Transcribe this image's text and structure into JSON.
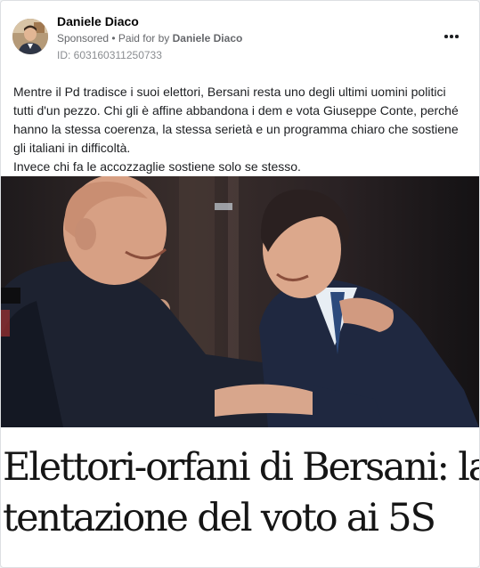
{
  "post": {
    "page_name": "Daniele Diaco",
    "sponsored_label": "Sponsored",
    "paid_for_prefix": " • Paid for by ",
    "paid_for_name": "Daniele Diaco",
    "ad_id": "ID: 603160311250733",
    "menu_icon": "more-horizontal-icon",
    "text_lines": [
      "Mentre il Pd tradisce i suoi elettori, Bersani resta uno degli ultimi uomini politici",
      "tutti d'un pezzo. Chi gli è affine abbandona i dem e vota Giuseppe Conte, perché",
      "hanno la stessa coerenza, la stessa serietà e un programma chiaro che sostiene",
      "gli italiani in difficoltà.",
      "Invece chi fa le accozzaglie sostiene solo se stesso."
    ]
  },
  "creative": {
    "headline_lines": [
      "Elettori-orfani di Bersani: la",
      "tentazione del voto ai 5S"
    ]
  }
}
